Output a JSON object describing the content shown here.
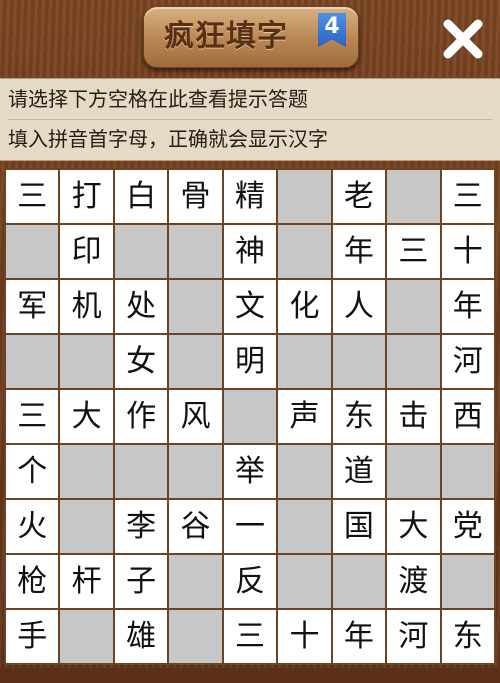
{
  "header": {
    "title": "疯狂填字",
    "level": "4",
    "close_icon": "close-x-icon"
  },
  "hint": {
    "line1": "请选择下方空格在此查看提示答题",
    "line2": "填入拼音首字母，正确就会显示汉字"
  },
  "board": {
    "rows": 9,
    "cols": 9,
    "cells": [
      [
        "三",
        "打",
        "白",
        "骨",
        "精",
        null,
        "老",
        null,
        "三"
      ],
      [
        null,
        "印",
        null,
        null,
        "神",
        null,
        "年",
        "三",
        "十"
      ],
      [
        "军",
        "机",
        "处",
        null,
        "文",
        "化",
        "人",
        null,
        "年"
      ],
      [
        null,
        null,
        "女",
        null,
        "明",
        null,
        null,
        null,
        "河"
      ],
      [
        "三",
        "大",
        "作",
        "风",
        null,
        "声",
        "东",
        "击",
        "西"
      ],
      [
        "个",
        null,
        null,
        null,
        "举",
        null,
        "道",
        null,
        null
      ],
      [
        "火",
        null,
        "李",
        "谷",
        "一",
        null,
        "国",
        "大",
        "党"
      ],
      [
        "枪",
        "杆",
        "子",
        null,
        "反",
        null,
        null,
        "渡",
        null
      ],
      [
        "手",
        null,
        "雄",
        null,
        "三",
        "十",
        "年",
        "河",
        "东"
      ]
    ],
    "colors": {
      "filled": "#ffffff",
      "empty": "#c7c7c7",
      "grid_line": "#6b4426"
    }
  }
}
